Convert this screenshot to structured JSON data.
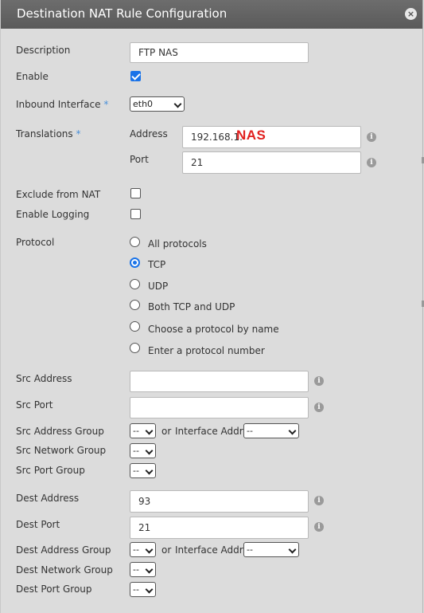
{
  "dialog": {
    "title": "Destination NAT Rule Configuration",
    "close_glyph": "×"
  },
  "fields": {
    "description_label": "Description",
    "description_value": "FTP NAS",
    "enable_label": "Enable",
    "enable_checked": true,
    "inbound_label": "Inbound Interface",
    "required_mark": "*",
    "inbound_value": "eth0",
    "translations_label": "Translations",
    "address_label": "Address",
    "address_value": "192.168.1.",
    "address_overlay": "NAS",
    "port_label": "Port",
    "port_value": "21",
    "exclude_label": "Exclude from NAT",
    "logging_label": "Enable Logging",
    "protocol_label": "Protocol"
  },
  "protocols": [
    {
      "label": "All protocols",
      "selected": false
    },
    {
      "label": "TCP",
      "selected": true
    },
    {
      "label": "UDP",
      "selected": false
    },
    {
      "label": "Both TCP and UDP",
      "selected": false
    },
    {
      "label": "Choose a protocol by name",
      "selected": false
    },
    {
      "label": "Enter a protocol number",
      "selected": false
    }
  ],
  "src": {
    "address_label": "Src Address",
    "port_label": "Src Port",
    "address_group_label": "Src Address Group",
    "network_group_label": "Src Network Group",
    "port_group_label": "Src Port Group"
  },
  "dest": {
    "address_label": "Dest Address",
    "address_value": "93",
    "port_label": "Dest Port",
    "port_value": "21",
    "address_group_label": "Dest Address Group",
    "network_group_label": "Dest Network Group",
    "port_group_label": "Dest Port Group"
  },
  "common": {
    "dash_option": "--",
    "or_text": "or",
    "interface_addr_label": "Interface Addr",
    "info_glyph": "i"
  },
  "colors": {
    "titlebar": "#5f5f5f",
    "accent": "#1a73e8",
    "required": "#4a90d9",
    "nas_tag": "#e1201f"
  }
}
